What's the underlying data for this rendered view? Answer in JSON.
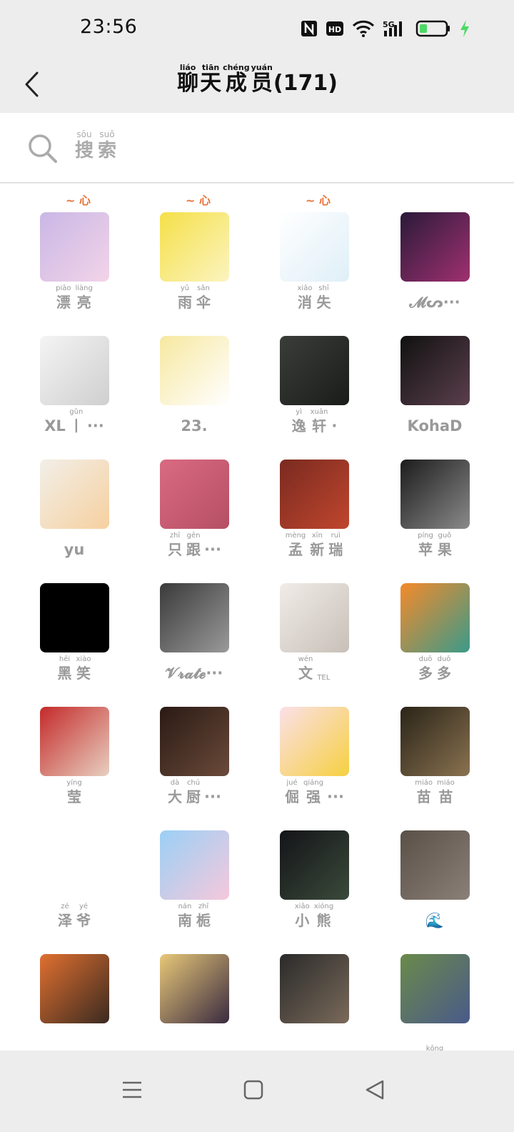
{
  "status_bar": {
    "time": "23:56",
    "icons": [
      "nfc-icon",
      "hd-icon",
      "wifi-icon",
      "5g-signal-icon",
      "battery-icon",
      "charging-icon"
    ],
    "battery_color": "#4cd964"
  },
  "header": {
    "title_chars": [
      {
        "py": "liáo",
        "hz": "聊"
      },
      {
        "py": "tiān",
        "hz": "天"
      },
      {
        "py": "chéng",
        "hz": "成"
      },
      {
        "py": "yuán",
        "hz": "员"
      }
    ],
    "count": "(171)"
  },
  "search": {
    "chars": [
      {
        "py": "sōu",
        "hz": "搜"
      },
      {
        "py": "suǒ",
        "hz": "索"
      }
    ]
  },
  "members": [
    {
      "name": [
        {
          "py": "piāo",
          "hz": "漂"
        },
        {
          "py": "liàng",
          "hz": "亮"
        }
      ],
      "bg": [
        "#c9b7e6",
        "#f3d4e8"
      ]
    },
    {
      "name": [
        {
          "py": "yǔ",
          "hz": "雨"
        },
        {
          "py": "sǎn",
          "hz": "伞"
        }
      ],
      "bg": [
        "#f5e048",
        "#fbf4c0"
      ]
    },
    {
      "name": [
        {
          "py": "xiāo",
          "hz": "消"
        },
        {
          "py": "shī",
          "hz": "失"
        }
      ],
      "bg": [
        "#ffffff",
        "#dfeff8"
      ]
    },
    {
      "plain": "𝓜ᔕ···",
      "bg": [
        "#2a1a3a",
        "#a03070"
      ]
    },
    {
      "plain": "XL",
      "name": [
        {
          "py": "gǔn",
          "hz": "丨"
        }
      ],
      "suffix": "···",
      "bg": [
        "#f4f4f4",
        "#cfcfcf"
      ]
    },
    {
      "plain": "23.",
      "bg": [
        "#f7e8a0",
        "#ffffff"
      ]
    },
    {
      "name": [
        {
          "py": "yì",
          "hz": "逸"
        },
        {
          "py": "xuān",
          "hz": "轩"
        }
      ],
      "suffix": "·",
      "bg": [
        "#3a3d38",
        "#1a1c1a"
      ]
    },
    {
      "plain": "KohaD",
      "bg": [
        "#111111",
        "#5b3f4c"
      ]
    },
    {
      "plain": "yu",
      "bg": [
        "#f2efe8",
        "#f6d0a0"
      ]
    },
    {
      "name": [
        {
          "py": "zhī",
          "hz": "只"
        },
        {
          "py": "gēn",
          "hz": "跟"
        }
      ],
      "suffix": "···",
      "bg": [
        "#d96a82",
        "#b64f64"
      ]
    },
    {
      "name": [
        {
          "py": "mèng",
          "hz": "孟"
        },
        {
          "py": "xīn",
          "hz": "新"
        },
        {
          "py": "ruì",
          "hz": "瑞"
        }
      ],
      "bg": [
        "#7a2a20",
        "#c0462e"
      ]
    },
    {
      "name": [
        {
          "py": "píng",
          "hz": "苹"
        },
        {
          "py": "guǒ",
          "hz": "果"
        }
      ],
      "bg": [
        "#1c1c1c",
        "#8a8a8a"
      ]
    },
    {
      "name": [
        {
          "py": "hēi",
          "hz": "黑"
        },
        {
          "py": "xiào",
          "hz": "笑"
        }
      ],
      "bg": [
        "#000000",
        "#000000"
      ]
    },
    {
      "plain": "𝓥𝓻𝓪𝓽𝓮···",
      "bg": [
        "#3a3a3a",
        "#9a9a9a"
      ]
    },
    {
      "name": [
        {
          "py": "wén",
          "hz": "文"
        },
        {
          "py": "TEL",
          "hz": " "
        }
      ],
      "bg": [
        "#f1ece8",
        "#c8c0b8"
      ]
    },
    {
      "name": [
        {
          "py": "duō",
          "hz": "多"
        },
        {
          "py": "duō",
          "hz": "多"
        }
      ],
      "bg": [
        "#f58a2a",
        "#3a9a8a"
      ]
    },
    {
      "name": [
        {
          "py": "yíng",
          "hz": "莹"
        }
      ],
      "bg": [
        "#c42a2a",
        "#e8d0c0"
      ]
    },
    {
      "name": [
        {
          "py": "dà",
          "hz": "大"
        },
        {
          "py": "chú",
          "hz": "厨"
        }
      ],
      "suffix": "···",
      "bg": [
        "#2a1a14",
        "#6a4a3a"
      ]
    },
    {
      "name": [
        {
          "py": "jué",
          "hz": "倔"
        },
        {
          "py": "qiáng",
          "hz": "强"
        }
      ],
      "suffix": "···",
      "bg": [
        "#fbe0e8",
        "#f6d040"
      ]
    },
    {
      "name": [
        {
          "py": "miáo",
          "hz": "苗"
        },
        {
          "py": "miáo",
          "hz": "苗"
        }
      ],
      "bg": [
        "#2a2418",
        "#8a7250"
      ]
    },
    {
      "name": [
        {
          "py": "zé",
          "hz": "泽"
        },
        {
          "py": "yé",
          "hz": "爷"
        }
      ],
      "bg": [
        "#ffffff",
        "#ffffff"
      ]
    },
    {
      "name": [
        {
          "py": "nán",
          "hz": "南"
        },
        {
          "py": "zhī",
          "hz": "栀"
        }
      ],
      "bg": [
        "#9ad0f6",
        "#f6c8dc"
      ]
    },
    {
      "name": [
        {
          "py": "xiǎo",
          "hz": "小"
        },
        {
          "py": "xióng",
          "hz": "熊"
        }
      ],
      "bg": [
        "#141418",
        "#3a4a3a"
      ]
    },
    {
      "plain": "🌊",
      "bg": [
        "#5a5048",
        "#8a8078"
      ]
    },
    {
      "plain": "",
      "bg": [
        "#e07030",
        "#3a2a20"
      ]
    },
    {
      "plain": "",
      "bg": [
        "#e8c878",
        "#3a2a40"
      ]
    },
    {
      "plain": "",
      "bg": [
        "#2a2a2a",
        "#7a6a5a"
      ]
    },
    {
      "name": [
        {
          "py": "kōng",
          "hz": " "
        }
      ],
      "bg": [
        "#6a8a4a",
        "#4a5a8a"
      ]
    }
  ],
  "partial_top_marks": [
    "~ 心",
    "~ 心",
    "~ 心"
  ],
  "bottom_nav": [
    "menu-icon",
    "home-icon",
    "back-triangle-icon"
  ]
}
